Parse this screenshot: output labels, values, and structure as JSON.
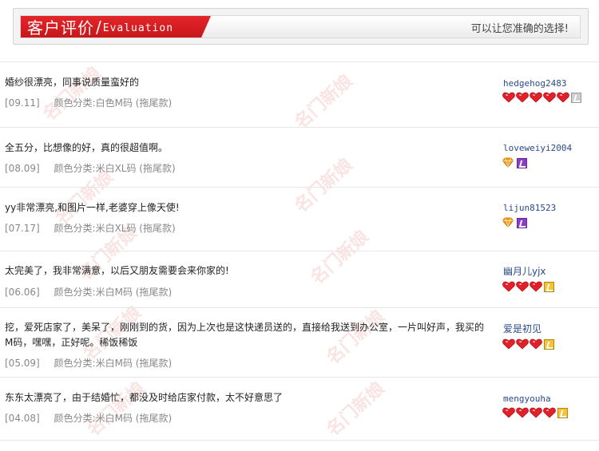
{
  "header": {
    "title_cn": "客户评价",
    "title_slash": "/",
    "title_en": "Evaluation",
    "tagline": "可以让您准确的选择!"
  },
  "watermark": "名门新娘",
  "reviews": [
    {
      "text": "婚纱很漂亮，同事说质量蛮好的",
      "date": "[09.11]",
      "spec": "颜色分类:白色M码 (拖尾款)",
      "user": "hedgehog2483",
      "badges": [
        "heart",
        "heart",
        "heart",
        "heart",
        "heart",
        "square-gray"
      ]
    },
    {
      "text": "全五分，比想像的好，真的很超值啊。",
      "date": "[08.09]",
      "spec": "颜色分类:米白XL码 (拖尾款)",
      "user": "loveweiyi2004",
      "badges": [
        "diamond",
        "square-purple"
      ]
    },
    {
      "text": "yy非常漂亮,和图片一样,老婆穿上像天使!",
      "date": "[07.17]",
      "spec": "颜色分类:米白XL码 (拖尾款)",
      "user": "lijun81523",
      "badges": [
        "diamond",
        "square-purple"
      ]
    },
    {
      "text": "太完美了，我非常满意，以后又朋友需要会来你家的!",
      "date": "[06.06]",
      "spec": "颜色分类:米白M码 (拖尾款)",
      "user": "幽月儿yjx",
      "badges": [
        "heart",
        "heart",
        "heart",
        "square-gold"
      ]
    },
    {
      "text": "挖，爱死店家了，美呆了，刚刚到的货，因为上次也是这快递员送的，直接给我送到办公室，一片叫好声，我买的M码，嘿嘿，正好呢。稀饭稀饭",
      "date": "[05.09]",
      "spec": "颜色分类:米白M码 (拖尾款)",
      "user": "爱是初见",
      "badges": [
        "heart",
        "heart",
        "heart",
        "square-gold"
      ]
    },
    {
      "text": "东东太漂亮了，由于结婚忙，都没及时给店家付款，太不好意思了",
      "date": "[04.08]",
      "spec": "颜色分类:米白M码 (拖尾款)",
      "user": "mengyouha",
      "badges": [
        "heart",
        "heart",
        "heart",
        "heart",
        "square-gold"
      ]
    }
  ]
}
